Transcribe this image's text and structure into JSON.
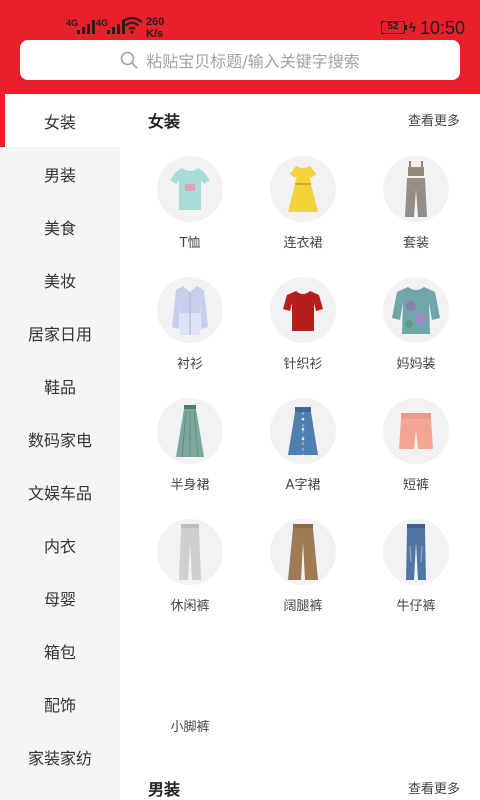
{
  "status_bar": {
    "sim1": "4G",
    "sim2": "4G",
    "speed_value": "260",
    "speed_unit": "K/s",
    "battery": "52",
    "time": "10:50"
  },
  "search": {
    "placeholder": "粘贴宝贝标题/输入关键字搜索",
    "icon": "search-icon"
  },
  "colors": {
    "brand": "#e8202a",
    "sidebar_bg": "#f5f5f5",
    "circle_bg": "#f2f2f4"
  },
  "sidebar": {
    "items": [
      {
        "label": "女装",
        "active": true
      },
      {
        "label": "男装"
      },
      {
        "label": "美食"
      },
      {
        "label": "美妆"
      },
      {
        "label": "居家日用"
      },
      {
        "label": "鞋品"
      },
      {
        "label": "数码家电"
      },
      {
        "label": "文娱车品"
      },
      {
        "label": "内衣"
      },
      {
        "label": "母婴"
      },
      {
        "label": "箱包"
      },
      {
        "label": "配饰"
      },
      {
        "label": "家装家纺"
      }
    ]
  },
  "sections": [
    {
      "title": "女装",
      "more": "查看更多",
      "items": [
        {
          "label": "T恤",
          "icon": "tshirt-icon"
        },
        {
          "label": "连衣裙",
          "icon": "dress-icon"
        },
        {
          "label": "套装",
          "icon": "suit-set-icon"
        },
        {
          "label": "衬衫",
          "icon": "shirt-icon"
        },
        {
          "label": "针织衫",
          "icon": "knit-sweater-icon"
        },
        {
          "label": "妈妈装",
          "icon": "mom-wear-icon"
        },
        {
          "label": "半身裙",
          "icon": "skirt-icon"
        },
        {
          "label": "A字裙",
          "icon": "a-line-skirt-icon"
        },
        {
          "label": "短裤",
          "icon": "shorts-icon"
        },
        {
          "label": "休闲裤",
          "icon": "casual-pants-icon"
        },
        {
          "label": "阔腿裤",
          "icon": "wide-leg-pants-icon"
        },
        {
          "label": "牛仔裤",
          "icon": "jeans-icon"
        },
        {
          "label": "小脚裤",
          "icon": "skinny-pants-icon"
        }
      ]
    },
    {
      "title": "男装",
      "more": "查看更多"
    }
  ]
}
